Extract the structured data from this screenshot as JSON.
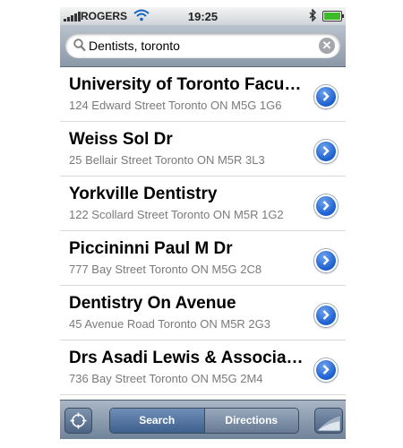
{
  "status_bar": {
    "carrier": "ROGERS",
    "time": "19:25"
  },
  "search": {
    "query": "Dentists, toronto"
  },
  "results": [
    {
      "name": "University of Toronto Faculty of Dentistry",
      "address": "124 Edward Street Toronto ON M5G 1G6"
    },
    {
      "name": "Weiss Sol Dr",
      "address": "25 Bellair Street Toronto ON M5R 3L3"
    },
    {
      "name": "Yorkville Dentistry",
      "address": "122 Scollard Street Toronto ON M5R 1G2"
    },
    {
      "name": "Piccininni Paul M Dr",
      "address": "777 Bay Street Toronto ON M5G 2C8"
    },
    {
      "name": "Dentistry On Avenue",
      "address": "45 Avenue Road Toronto ON M5R 2G3"
    },
    {
      "name": "Drs Asadi Lewis & Associates",
      "address": "736 Bay Street Toronto ON M5G 2M4"
    }
  ],
  "toolbar": {
    "search_label": "Search",
    "directions_label": "Directions"
  },
  "icons": {
    "signal": "signal-bars-icon",
    "wifi": "wifi-icon",
    "bluetooth": "bluetooth-icon",
    "battery": "battery-charging-icon",
    "search": "search-icon",
    "clear": "clear-icon",
    "disclosure": "chevron-right-icon",
    "locate": "crosshair-icon",
    "pagecurl": "page-curl-icon"
  },
  "colors": {
    "accent_blue": "#1a5fcf",
    "toolbar": "#6f8299",
    "battery_fill": "#3dbb2a"
  }
}
